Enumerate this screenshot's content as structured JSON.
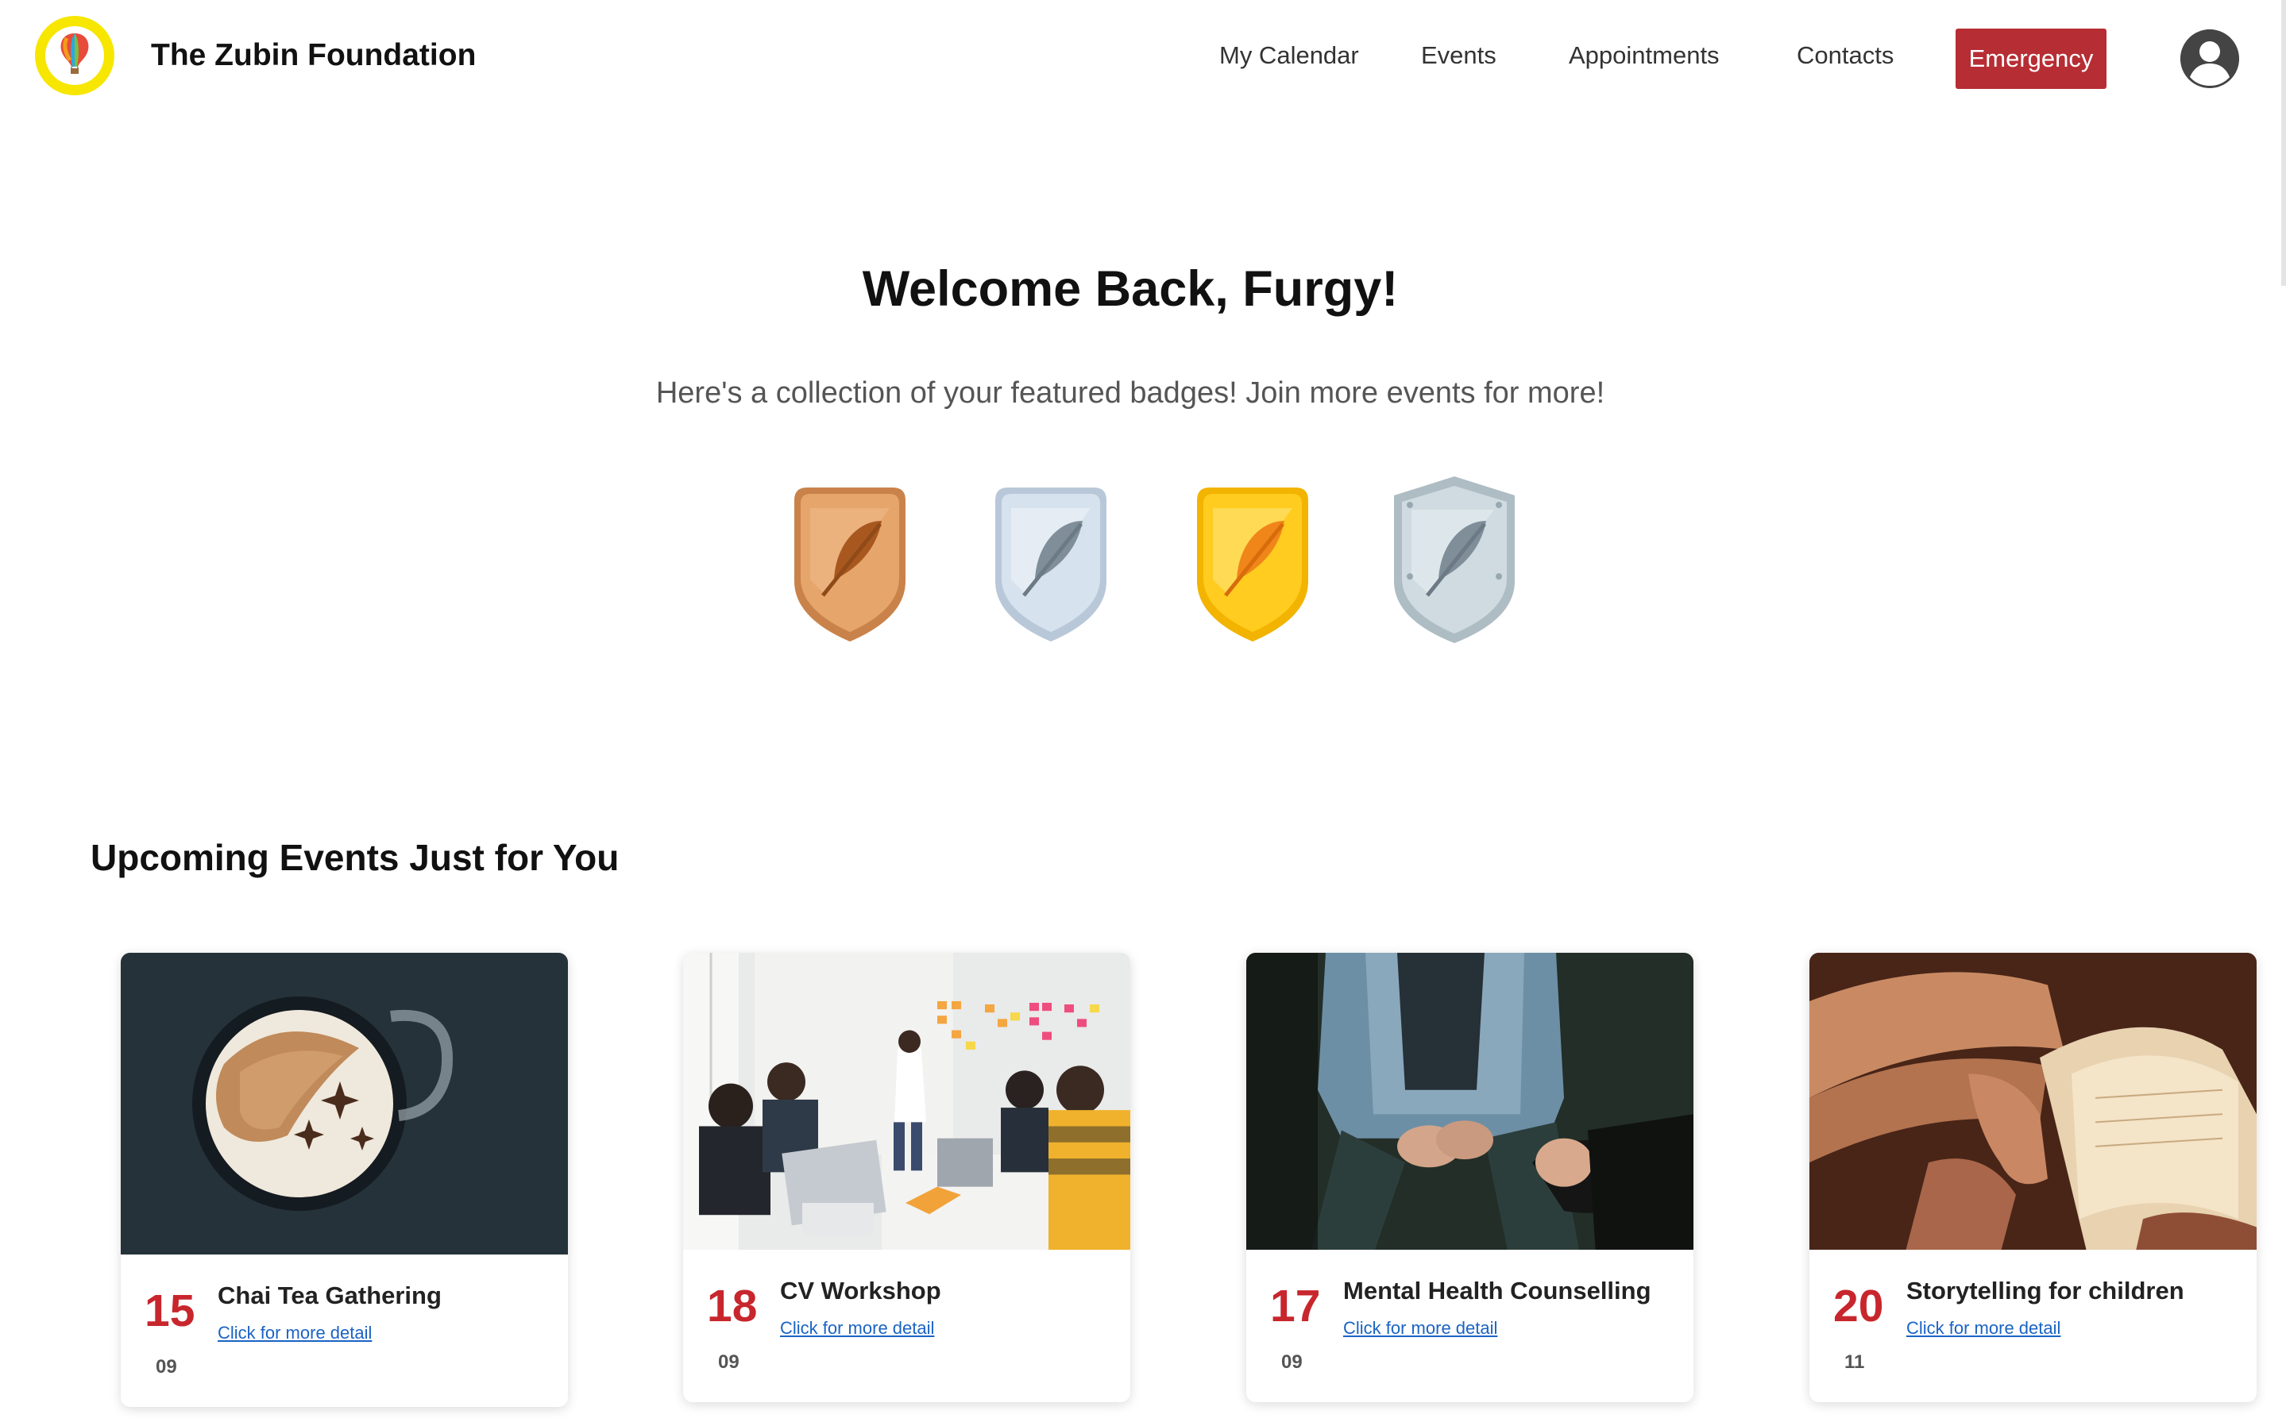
{
  "header": {
    "logo_text": "The Zubin Foundation",
    "brand": "The Zubin Foundation",
    "nav": [
      "My Calendar",
      "Events",
      "Appointments",
      "Contacts"
    ],
    "emergency": "Emergency"
  },
  "hero": {
    "welcome": "Welcome Back, Furgy!",
    "subtitle": "Here's a collection of your featured badges! Join more events for more!"
  },
  "badges": [
    {
      "name": "bronze",
      "color": "#d9955a"
    },
    {
      "name": "silver",
      "color": "#c9d7e6"
    },
    {
      "name": "gold",
      "color": "#ffc21a"
    },
    {
      "name": "platinum",
      "color": "#c6d3da"
    }
  ],
  "events": {
    "section_title": "Upcoming Events Just for You",
    "cards": [
      {
        "day": "15",
        "month": "09",
        "title": "Chai Tea Gathering",
        "link": "Click for more detail"
      },
      {
        "day": "18",
        "month": "09",
        "title": "CV Workshop",
        "link": "Click for more detail"
      },
      {
        "day": "17",
        "month": "09",
        "title": "Mental Health Counselling",
        "link": "Click for more detail"
      },
      {
        "day": "20",
        "month": "11",
        "title": "Storytelling for children",
        "link": "Click for more detail"
      }
    ]
  },
  "colors": {
    "emergency_bg": "#b72d34",
    "date_red": "#c8262d",
    "link_blue": "#1a63c4"
  }
}
